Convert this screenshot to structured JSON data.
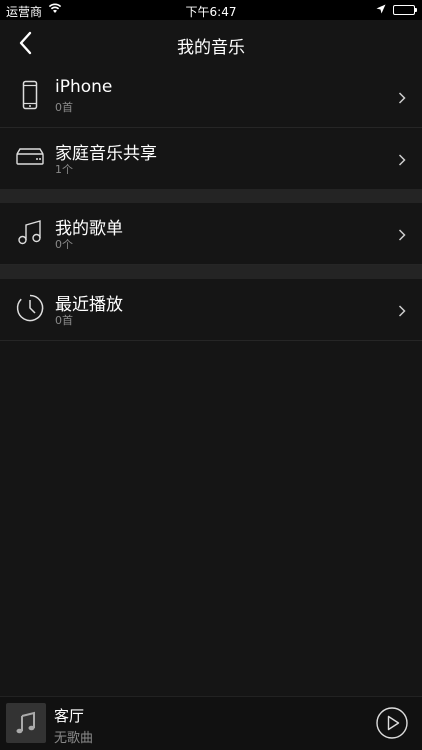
{
  "status_bar": {
    "carrier": "运营商",
    "time": "下午6:47"
  },
  "nav": {
    "title": "我的音乐"
  },
  "rows": [
    {
      "title": "iPhone",
      "sub": "0首",
      "icon": "iphone-icon"
    },
    {
      "title": "家庭音乐共享",
      "sub": "1个",
      "icon": "home-sharing-device-icon"
    },
    {
      "title": "我的歌单",
      "sub": "0个",
      "icon": "music-note-icon"
    },
    {
      "title": "最近播放",
      "sub": "0首",
      "icon": "clock-icon"
    }
  ],
  "mini_player": {
    "room": "客厅",
    "song": "无歌曲"
  },
  "colors": {
    "background": "#151515",
    "separator": "#242424",
    "secondary_text": "#8a8a8a"
  }
}
